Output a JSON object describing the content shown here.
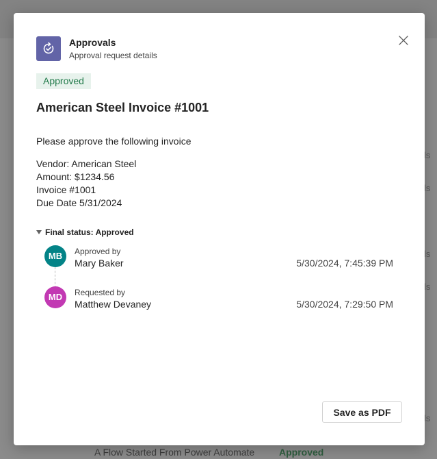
{
  "app": {
    "name": "Approvals",
    "subtitle": "Approval request details"
  },
  "request": {
    "status": "Approved",
    "title": "American Steel Invoice #1001",
    "message": "Please approve the following invoice",
    "details": [
      "Vendor: American Steel",
      "Amount: $1234.56",
      "Invoice #1001",
      "Due Date 5/31/2024"
    ]
  },
  "timeline": {
    "heading": "Final status: Approved",
    "entries": [
      {
        "initials": "MB",
        "role": "Approved by",
        "name": "Mary Baker",
        "time": "5/30/2024, 7:45:39 PM",
        "color": "#038387"
      },
      {
        "initials": "MD",
        "role": "Requested by",
        "name": "Matthew Devaney",
        "time": "5/30/2024, 7:29:50 PM",
        "color": "#c239b3"
      }
    ]
  },
  "actions": {
    "save_pdf_label": "Save as PDF"
  },
  "background": {
    "row_fragments": [
      "ls",
      "ls",
      "ls",
      "ls",
      "ls"
    ],
    "bottom_row_title": "A Flow Started From Power Automate",
    "bottom_row_status": "Approved"
  },
  "icons": {
    "app": "approvals-icon",
    "close": "close-icon",
    "toggle": "caret-down-icon"
  },
  "colors": {
    "brand": "#6264a7",
    "approved_bg": "#e7f2ec",
    "approved_text": "#237b4b"
  }
}
